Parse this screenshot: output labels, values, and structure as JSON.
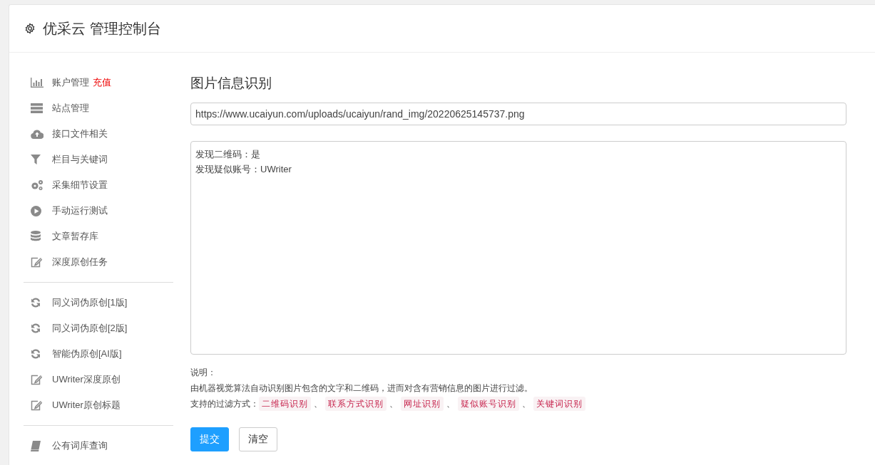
{
  "header": {
    "title": "优采云 管理控制台"
  },
  "sidebar": {
    "groups": [
      {
        "items": [
          {
            "label": "账户管理",
            "tag": "充值"
          },
          {
            "label": "站点管理"
          },
          {
            "label": "接口文件相关"
          },
          {
            "label": "栏目与关键词"
          },
          {
            "label": "采集细节设置"
          },
          {
            "label": "手动运行测试"
          },
          {
            "label": "文章暂存库"
          },
          {
            "label": "深度原创任务"
          }
        ]
      },
      {
        "items": [
          {
            "label": "同义词伪原创[1版]"
          },
          {
            "label": "同义词伪原创[2版]"
          },
          {
            "label": "智能伪原创[AI版]"
          },
          {
            "label": "UWriter深度原创"
          },
          {
            "label": "UWriter原创标题"
          }
        ]
      },
      {
        "items": [
          {
            "label": "公有词库查询"
          }
        ]
      }
    ]
  },
  "main": {
    "title": "图片信息识别",
    "url_field": {
      "value": "https://www.ucaiyun.com/uploads/ucaiyun/rand_img/20220625145737.png"
    },
    "result_field": {
      "lines": [
        "发现二维码：是",
        "发现疑似账号：UWriter"
      ]
    },
    "notes": {
      "heading": "说明：",
      "description": "由机器视觉算法自动识别图片包含的文字和二维码，进而对含有营销信息的图片进行过滤。",
      "methods_label": "支持的过滤方式：",
      "methods": [
        "二维码识别",
        "联系方式识别",
        "网址识别",
        "疑似账号识别",
        "关键词识别"
      ],
      "separator": "、"
    },
    "buttons": [
      {
        "label": "提交",
        "kind": "primary"
      },
      {
        "label": "清空",
        "kind": "default"
      }
    ]
  }
}
